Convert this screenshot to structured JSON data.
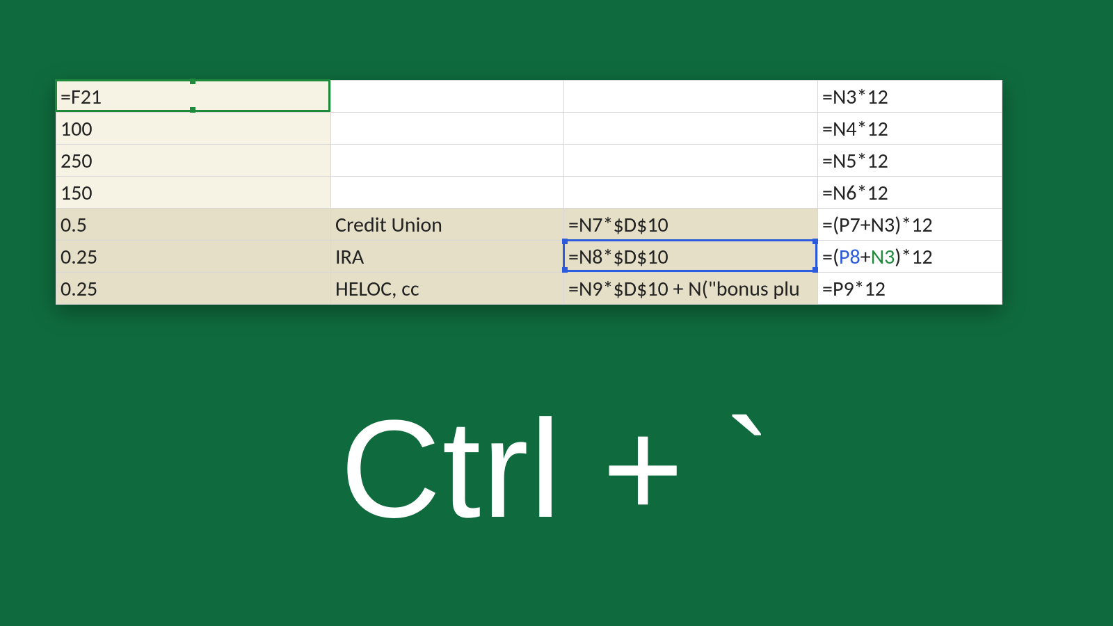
{
  "shortcut_label": "Ctrl + `",
  "grid": {
    "rows": [
      {
        "a": "=F21",
        "b": "",
        "c": "",
        "d": "=N3*12"
      },
      {
        "a": "100",
        "b": "",
        "c": "",
        "d": "=N4*12"
      },
      {
        "a": "250",
        "b": "",
        "c": "",
        "d": "=N5*12"
      },
      {
        "a": "150",
        "b": "",
        "c": "",
        "d": "=N6*12"
      },
      {
        "a": "0.5",
        "b": "Credit Union",
        "c": "=N7*$D$10",
        "d": "=(P7+N3)*12"
      },
      {
        "a": "0.25",
        "b": "IRA",
        "c": "=N8*$D$10",
        "d_pre": "=(",
        "d_ref1": "P8",
        "d_mid": "+",
        "d_ref2": "N3",
        "d_post": ")*12"
      },
      {
        "a": "0.25",
        "b": "HELOC, cc",
        "c": "=N9*$D$10 + N(\"bonus plu",
        "d": "=P9*12"
      }
    ]
  },
  "selection": {
    "green_cell": "A1",
    "blue_cell": "C6"
  }
}
